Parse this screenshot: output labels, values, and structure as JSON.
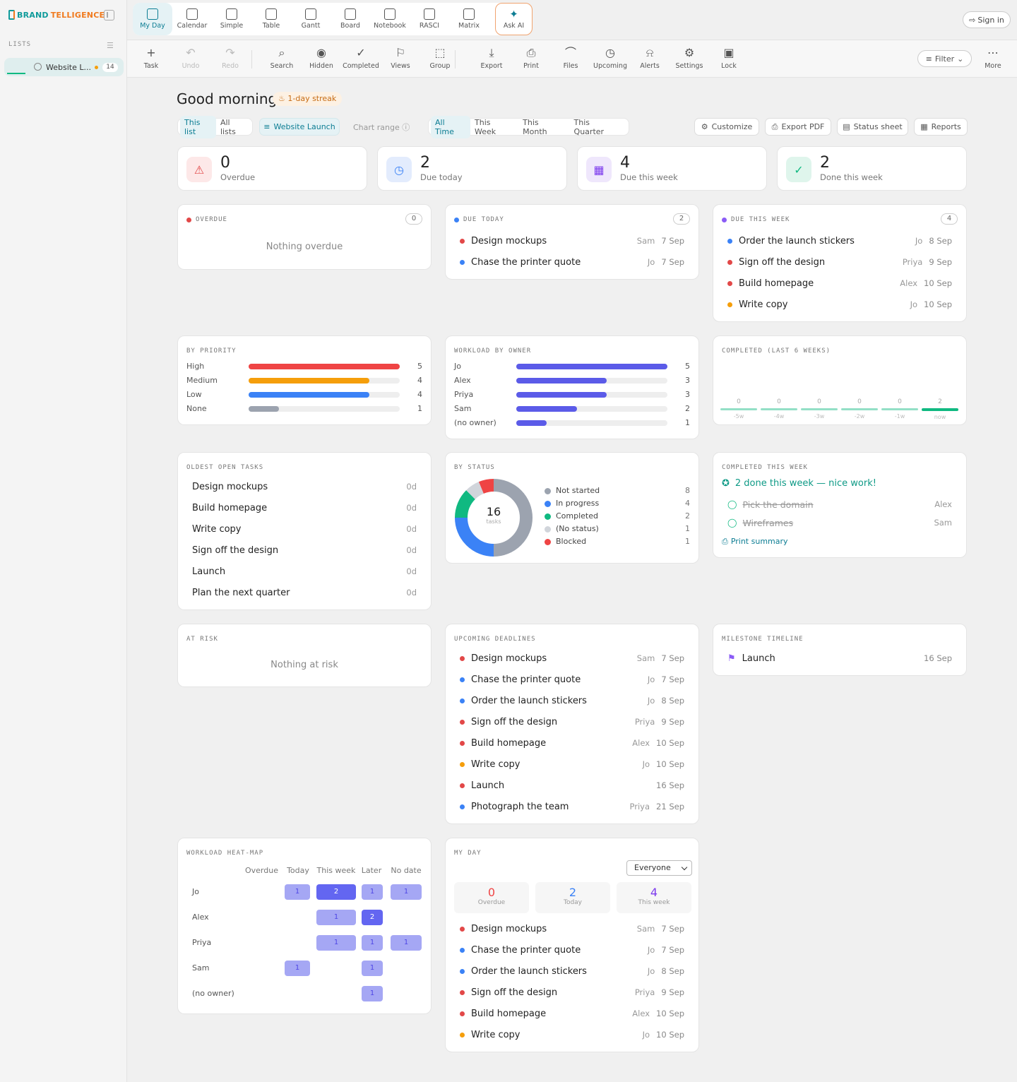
{
  "brand": {
    "part1": "BRAND",
    "part2": "TELLIGENCE"
  },
  "sidebar": {
    "lists_header": "LISTS",
    "list_item": {
      "label": "Website L...",
      "count": "14"
    }
  },
  "topnav": {
    "items": [
      {
        "label": "My Day",
        "icon": "my-day-icon"
      },
      {
        "label": "Calendar",
        "icon": "calendar-icon"
      },
      {
        "label": "Simple",
        "icon": "simple-list-icon"
      },
      {
        "label": "Table",
        "icon": "table-icon"
      },
      {
        "label": "Gantt",
        "icon": "gantt-icon"
      },
      {
        "label": "Board",
        "icon": "board-icon"
      },
      {
        "label": "Notebook",
        "icon": "notebook-icon"
      },
      {
        "label": "RASCI",
        "icon": "rasci-icon"
      },
      {
        "label": "Matrix",
        "icon": "matrix-icon"
      }
    ],
    "ask_ai": "Ask AI",
    "sign_in": "Sign in"
  },
  "toolbar": {
    "items": [
      "Task",
      "Undo",
      "Redo",
      "Search",
      "Hidden",
      "Completed",
      "Views",
      "Group",
      "Export",
      "Print",
      "Files",
      "Upcoming",
      "Alerts",
      "Settings",
      "Lock"
    ],
    "filter": "Filter",
    "more": "More"
  },
  "greeting": "Good morning",
  "streak": "1-day streak",
  "scope": {
    "this_list": "This list",
    "all_lists": "All lists",
    "current": "Website Launch"
  },
  "chart_range_label": "Chart range",
  "ranges": [
    "All Time",
    "This Week",
    "This Month",
    "This Quarter"
  ],
  "actions": {
    "customize": "Customize",
    "export_pdf": "Export PDF",
    "status_sheet": "Status sheet",
    "reports": "Reports"
  },
  "stats": [
    {
      "num": "0",
      "label": "Overdue"
    },
    {
      "num": "2",
      "label": "Due today"
    },
    {
      "num": "4",
      "label": "Due this week"
    },
    {
      "num": "2",
      "label": "Done this week"
    }
  ],
  "overdue": {
    "title": "OVERDUE",
    "count": "0",
    "empty": "Nothing overdue"
  },
  "due_today": {
    "title": "DUE TODAY",
    "count": "2",
    "items": [
      {
        "name": "Design mockups",
        "owner": "Sam",
        "date": "7 Sep",
        "color": "#e24848"
      },
      {
        "name": "Chase the printer quote",
        "owner": "Jo",
        "date": "7 Sep",
        "color": "#3b82f6"
      }
    ]
  },
  "due_week": {
    "title": "DUE THIS WEEK",
    "count": "4",
    "items": [
      {
        "name": "Order the launch stickers",
        "owner": "Jo",
        "date": "8 Sep",
        "color": "#3b82f6"
      },
      {
        "name": "Sign off the design",
        "owner": "Priya",
        "date": "9 Sep",
        "color": "#e24848"
      },
      {
        "name": "Build homepage",
        "owner": "Alex",
        "date": "10 Sep",
        "color": "#e24848"
      },
      {
        "name": "Write copy",
        "owner": "Jo",
        "date": "10 Sep",
        "color": "#f59e0b"
      }
    ]
  },
  "by_priority": {
    "title": "BY PRIORITY",
    "max": 5,
    "rows": [
      {
        "label": "High",
        "value": 5,
        "color": "#ef4444"
      },
      {
        "label": "Medium",
        "value": 4,
        "color": "#f59e0b"
      },
      {
        "label": "Low",
        "value": 4,
        "color": "#3b82f6"
      },
      {
        "label": "None",
        "value": 1,
        "color": "#9ca3af"
      }
    ]
  },
  "workload": {
    "title": "WORKLOAD BY OWNER",
    "max": 5,
    "rows": [
      {
        "label": "Jo",
        "value": 5
      },
      {
        "label": "Alex",
        "value": 3
      },
      {
        "label": "Priya",
        "value": 3
      },
      {
        "label": "Sam",
        "value": 2
      },
      {
        "label": "(no owner)",
        "value": 1
      }
    ]
  },
  "completed_weeks": {
    "title": "COMPLETED (LAST 6 WEEKS)",
    "weeks": [
      {
        "label": "-5w",
        "value": "0"
      },
      {
        "label": "-4w",
        "value": "0"
      },
      {
        "label": "-3w",
        "value": "0"
      },
      {
        "label": "-2w",
        "value": "0"
      },
      {
        "label": "-1w",
        "value": "0"
      },
      {
        "label": "now",
        "value": "2"
      }
    ]
  },
  "oldest": {
    "title": "OLDEST OPEN TASKS",
    "items": [
      {
        "name": "Design mockups",
        "age": "0d"
      },
      {
        "name": "Build homepage",
        "age": "0d"
      },
      {
        "name": "Write copy",
        "age": "0d"
      },
      {
        "name": "Sign off the design",
        "age": "0d"
      },
      {
        "name": "Launch",
        "age": "0d"
      },
      {
        "name": "Plan the next quarter",
        "age": "0d"
      }
    ]
  },
  "by_status": {
    "title": "BY STATUS",
    "total": "16",
    "total_label": "tasks",
    "rows": [
      {
        "label": "Not started",
        "value": 8,
        "color": "#9ca3af"
      },
      {
        "label": "In progress",
        "value": 4,
        "color": "#3b82f6"
      },
      {
        "label": "Completed",
        "value": 2,
        "color": "#10b981"
      },
      {
        "label": "(No status)",
        "value": 1,
        "color": "#d1d5db"
      },
      {
        "label": "Blocked",
        "value": 1,
        "color": "#ef4444"
      }
    ]
  },
  "completed_week": {
    "title": "COMPLETED THIS WEEK",
    "headline": "2 done this week — nice work!",
    "items": [
      {
        "name": "Pick the domain",
        "owner": "Alex"
      },
      {
        "name": "Wireframes",
        "owner": "Sam"
      }
    ],
    "print": "Print summary"
  },
  "at_risk": {
    "title": "AT RISK",
    "empty": "Nothing at risk"
  },
  "upcoming": {
    "title": "UPCOMING DEADLINES",
    "items": [
      {
        "name": "Design mockups",
        "owner": "Sam",
        "date": "7 Sep",
        "color": "#e24848"
      },
      {
        "name": "Chase the printer quote",
        "owner": "Jo",
        "date": "7 Sep",
        "color": "#3b82f6"
      },
      {
        "name": "Order the launch stickers",
        "owner": "Jo",
        "date": "8 Sep",
        "color": "#3b82f6"
      },
      {
        "name": "Sign off the design",
        "owner": "Priya",
        "date": "9 Sep",
        "color": "#e24848"
      },
      {
        "name": "Build homepage",
        "owner": "Alex",
        "date": "10 Sep",
        "color": "#e24848"
      },
      {
        "name": "Write copy",
        "owner": "Jo",
        "date": "10 Sep",
        "color": "#f59e0b"
      },
      {
        "name": "Launch",
        "owner": "",
        "date": "16 Sep",
        "color": "#e24848"
      },
      {
        "name": "Photograph the team",
        "owner": "Priya",
        "date": "21 Sep",
        "color": "#3b82f6"
      }
    ]
  },
  "milestone": {
    "title": "MILESTONE TIMELINE",
    "items": [
      {
        "name": "Launch",
        "date": "16 Sep"
      }
    ]
  },
  "heatmap": {
    "title": "WORKLOAD HEAT-MAP",
    "columns": [
      "Overdue",
      "Today",
      "This week",
      "Later",
      "No date"
    ],
    "rows": [
      {
        "name": "Jo",
        "cells": [
          null,
          1,
          2,
          1,
          1
        ]
      },
      {
        "name": "Alex",
        "cells": [
          null,
          null,
          1,
          2,
          null
        ]
      },
      {
        "name": "Priya",
        "cells": [
          null,
          null,
          1,
          1,
          1
        ]
      },
      {
        "name": "Sam",
        "cells": [
          null,
          1,
          null,
          1,
          null
        ]
      },
      {
        "name": "(no owner)",
        "cells": [
          null,
          null,
          null,
          1,
          null
        ]
      }
    ]
  },
  "my_day": {
    "title": "MY DAY",
    "filter": "Everyone",
    "summary": [
      {
        "num": "0",
        "label": "Overdue",
        "color": "#ef4444"
      },
      {
        "num": "2",
        "label": "Today",
        "color": "#3b82f6"
      },
      {
        "num": "4",
        "label": "This week",
        "color": "#7c3aed"
      }
    ],
    "items": [
      {
        "name": "Design mockups",
        "owner": "Sam",
        "date": "7 Sep",
        "color": "#e24848"
      },
      {
        "name": "Chase the printer quote",
        "owner": "Jo",
        "date": "7 Sep",
        "color": "#3b82f6"
      },
      {
        "name": "Order the launch stickers",
        "owner": "Jo",
        "date": "8 Sep",
        "color": "#3b82f6"
      },
      {
        "name": "Sign off the design",
        "owner": "Priya",
        "date": "9 Sep",
        "color": "#e24848"
      },
      {
        "name": "Build homepage",
        "owner": "Alex",
        "date": "10 Sep",
        "color": "#e24848"
      },
      {
        "name": "Write copy",
        "owner": "Jo",
        "date": "10 Sep",
        "color": "#f59e0b"
      }
    ]
  },
  "colors": {
    "accent": "#0c7d93",
    "workload_bar": "#5b5be8",
    "heat_light": "#a5a7f4",
    "heat_dark": "#6366f1"
  }
}
